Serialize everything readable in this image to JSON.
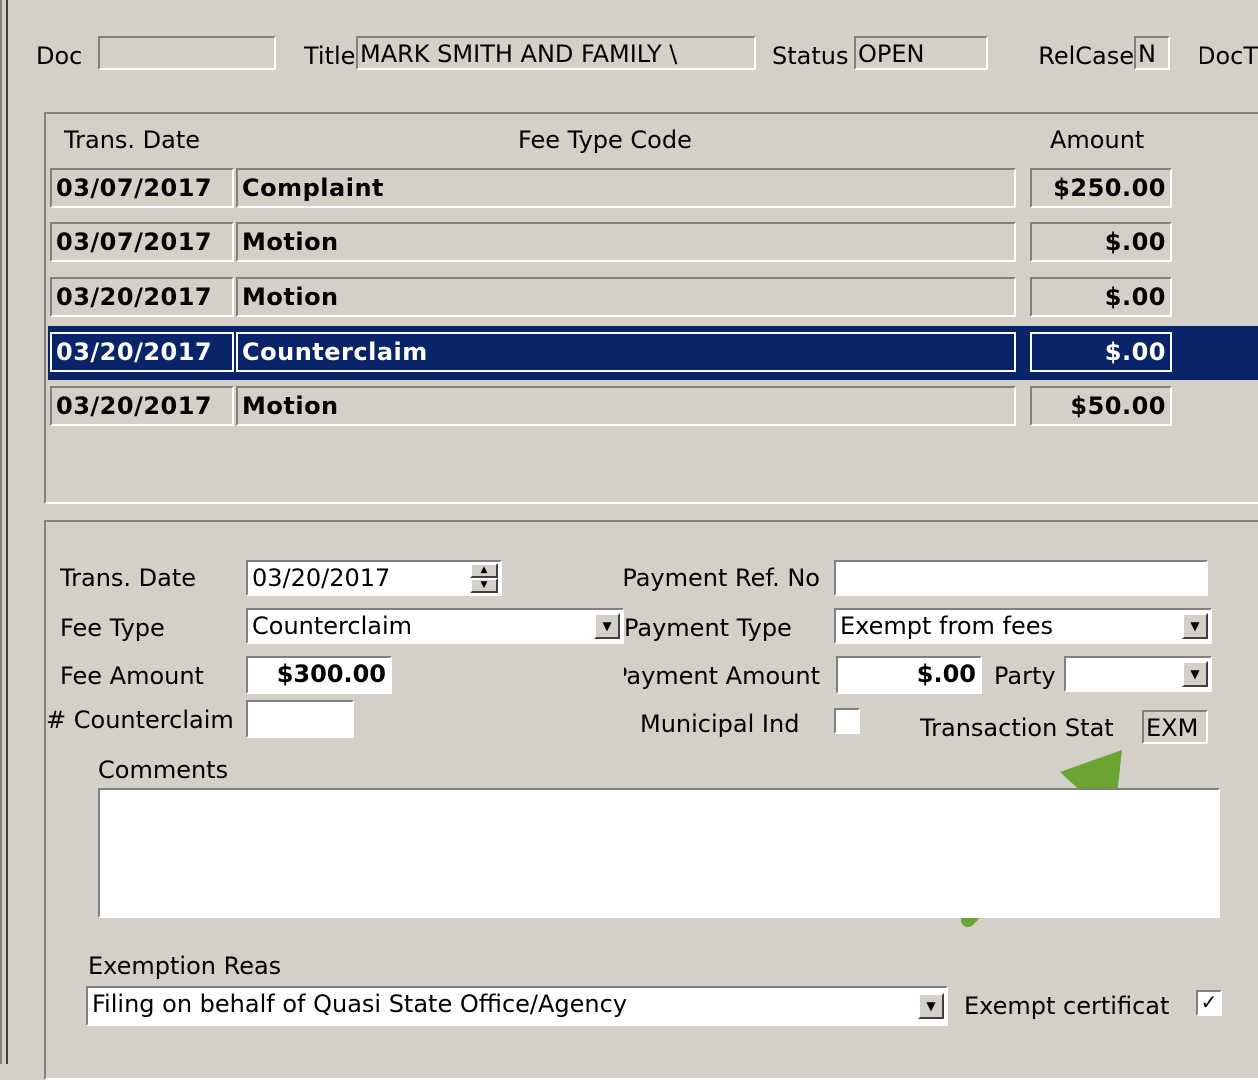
{
  "header": {
    "doc_label": "Doc",
    "doc_value": "",
    "title_label": "Title",
    "title_value": "MARK SMITH AND FAMILY \\",
    "status_label": "Status",
    "status_value": "OPEN",
    "relcase_label": "RelCase",
    "relcase_value": "N",
    "doct_label": "DocT"
  },
  "grid": {
    "columns": [
      "Trans. Date",
      "Fee Type Code",
      "Amount"
    ],
    "rows": [
      {
        "date": "03/07/2017",
        "code": "Complaint",
        "amount": "$250.00",
        "selected": false
      },
      {
        "date": "03/07/2017",
        "code": "Motion",
        "amount": "$.00",
        "selected": false
      },
      {
        "date": "03/20/2017",
        "code": "Motion",
        "amount": "$.00",
        "selected": false
      },
      {
        "date": "03/20/2017",
        "code": "Counterclaim",
        "amount": "$.00",
        "selected": true
      },
      {
        "date": "03/20/2017",
        "code": "Motion",
        "amount": "$50.00",
        "selected": false
      }
    ]
  },
  "form": {
    "trans_date_label": "Trans. Date",
    "trans_date_value": "03/20/2017",
    "fee_type_label": "Fee Type",
    "fee_type_value": "Counterclaim",
    "fee_amount_label": "Fee Amount",
    "fee_amount_value": "$300.00",
    "counterclaim_label": "Counterclaim #",
    "counterclaim_value": "",
    "payment_ref_label": "Payment Ref. No.",
    "payment_ref_value": "",
    "payment_type_label": "Payment Type",
    "payment_type_value": "Exempt from fees",
    "payment_amount_label": "Payment Amount",
    "payment_amount_value": "$.00",
    "party_label": "Party",
    "party_value": "",
    "municipal_label": "Municipal Ind",
    "transaction_status_label": "Transaction Stat",
    "transaction_status_value": "EXM",
    "comments_label": "Comments",
    "comments_value": "",
    "exemption_label": "Exemption Reas",
    "exemption_value": "Filing on behalf of Quasi State Office/Agency",
    "exempt_cert_label": "Exempt certificat"
  },
  "colors": {
    "background": "#d4d0c8",
    "selection": "#0a246a",
    "arrow": "#6aa534"
  }
}
